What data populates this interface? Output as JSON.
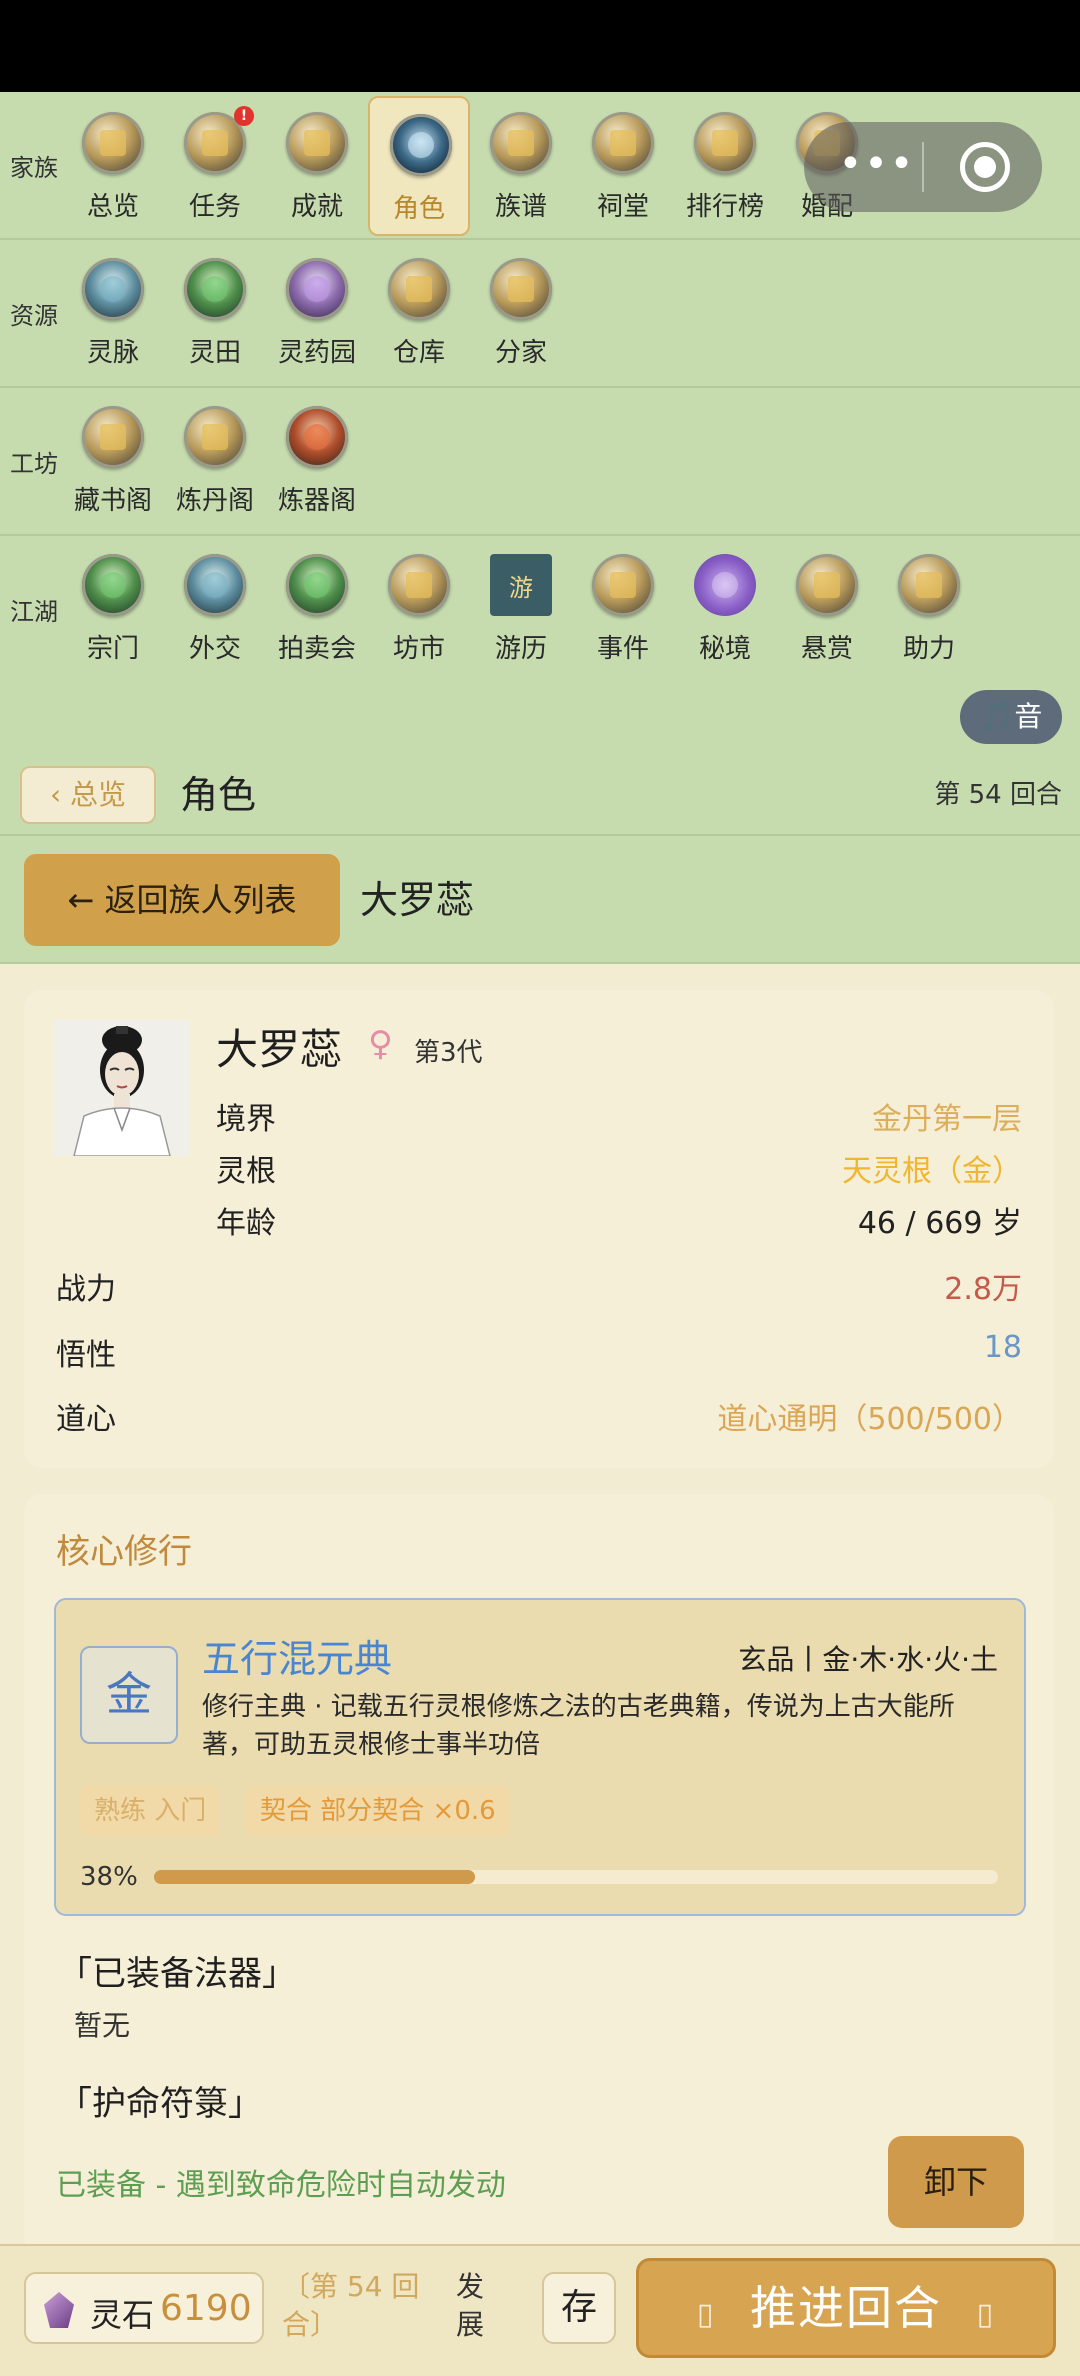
{
  "nav": {
    "rows": [
      {
        "label": "家族",
        "items": [
          {
            "label": "总览",
            "icon": "overview-icon"
          },
          {
            "label": "任务",
            "icon": "task-icon",
            "badge": "!"
          },
          {
            "label": "成就",
            "icon": "achievement-icon"
          },
          {
            "label": "角色",
            "icon": "character-icon",
            "active": true
          },
          {
            "label": "族谱",
            "icon": "family-tree-icon"
          },
          {
            "label": "祠堂",
            "icon": "ancestral-hall-icon"
          },
          {
            "label": "排行榜",
            "icon": "leaderboard-icon"
          },
          {
            "label": "婚配",
            "icon": "marriage-icon"
          }
        ]
      },
      {
        "label": "资源",
        "items": [
          {
            "label": "灵脉",
            "icon": "spirit-vein-icon"
          },
          {
            "label": "灵田",
            "icon": "spirit-field-icon"
          },
          {
            "label": "灵药园",
            "icon": "herb-garden-icon"
          },
          {
            "label": "仓库",
            "icon": "warehouse-icon"
          },
          {
            "label": "分家",
            "icon": "branch-family-icon"
          }
        ]
      },
      {
        "label": "工坊",
        "items": [
          {
            "label": "藏书阁",
            "icon": "library-icon"
          },
          {
            "label": "炼丹阁",
            "icon": "alchemy-icon"
          },
          {
            "label": "炼器阁",
            "icon": "forge-icon"
          }
        ]
      },
      {
        "label": "江湖",
        "items": [
          {
            "label": "宗门",
            "icon": "sect-icon"
          },
          {
            "label": "外交",
            "icon": "diplomacy-icon"
          },
          {
            "label": "拍卖会",
            "icon": "auction-icon"
          },
          {
            "label": "坊市",
            "icon": "market-icon"
          },
          {
            "label": "游历",
            "icon": "travel-icon"
          },
          {
            "label": "事件",
            "icon": "event-icon"
          },
          {
            "label": "秘境",
            "icon": "secret-realm-icon"
          },
          {
            "label": "悬赏",
            "icon": "bounty-icon"
          },
          {
            "label": "助力",
            "icon": "boost-icon"
          }
        ]
      }
    ]
  },
  "music_button": "🎵音",
  "header": {
    "back_label": "‹ 总览",
    "title": "角色",
    "round": "第 54 回合"
  },
  "subheader": {
    "return_label": "← 返回族人列表",
    "name": "大罗蕊"
  },
  "character": {
    "name": "大罗蕊",
    "gender_symbol": "♀",
    "generation": "第3代",
    "stats": [
      {
        "key": "境界",
        "value": "金丹第一层",
        "color": "#dcae5a"
      },
      {
        "key": "灵根",
        "value": "天灵根（金）",
        "color": "#f0b631"
      },
      {
        "key": "年龄",
        "value": "46 / 669 岁",
        "color": "#222222"
      }
    ],
    "attributes": [
      {
        "key": "战力",
        "value": "2.8万",
        "color": "#c45a4a"
      },
      {
        "key": "悟性",
        "value": "18",
        "color": "#6a97c8"
      },
      {
        "key": "道心",
        "value": "道心通明（500/500）",
        "color": "#d9a656"
      }
    ]
  },
  "cultivation": {
    "section_title": "核心修行",
    "technique": {
      "element": "金",
      "name": "五行混元典",
      "grade": "玄品丨金·木·水·火·土",
      "description": "修行主典 · 记载五行灵根修炼之法的古老典籍，传说为上古大能所著，可助五灵根修士事半功倍",
      "tags": [
        "熟练 入门",
        "契合 部分契合 ×0.6"
      ],
      "progress_label": "38%",
      "progress": 0.38
    },
    "artifact_title": "「已装备法器」",
    "artifact_value": "暂无",
    "talisman_title": "「护命符箓」",
    "talisman_status": "已装备 - 遇到致命危险时自动发动",
    "unequip_label": "卸下"
  },
  "bottom": {
    "stone_label": "灵石",
    "stone_value": "6190",
    "round_info": "〔第 54 回合〕",
    "develop": "发展",
    "save": "存",
    "advance": "推进回合"
  }
}
